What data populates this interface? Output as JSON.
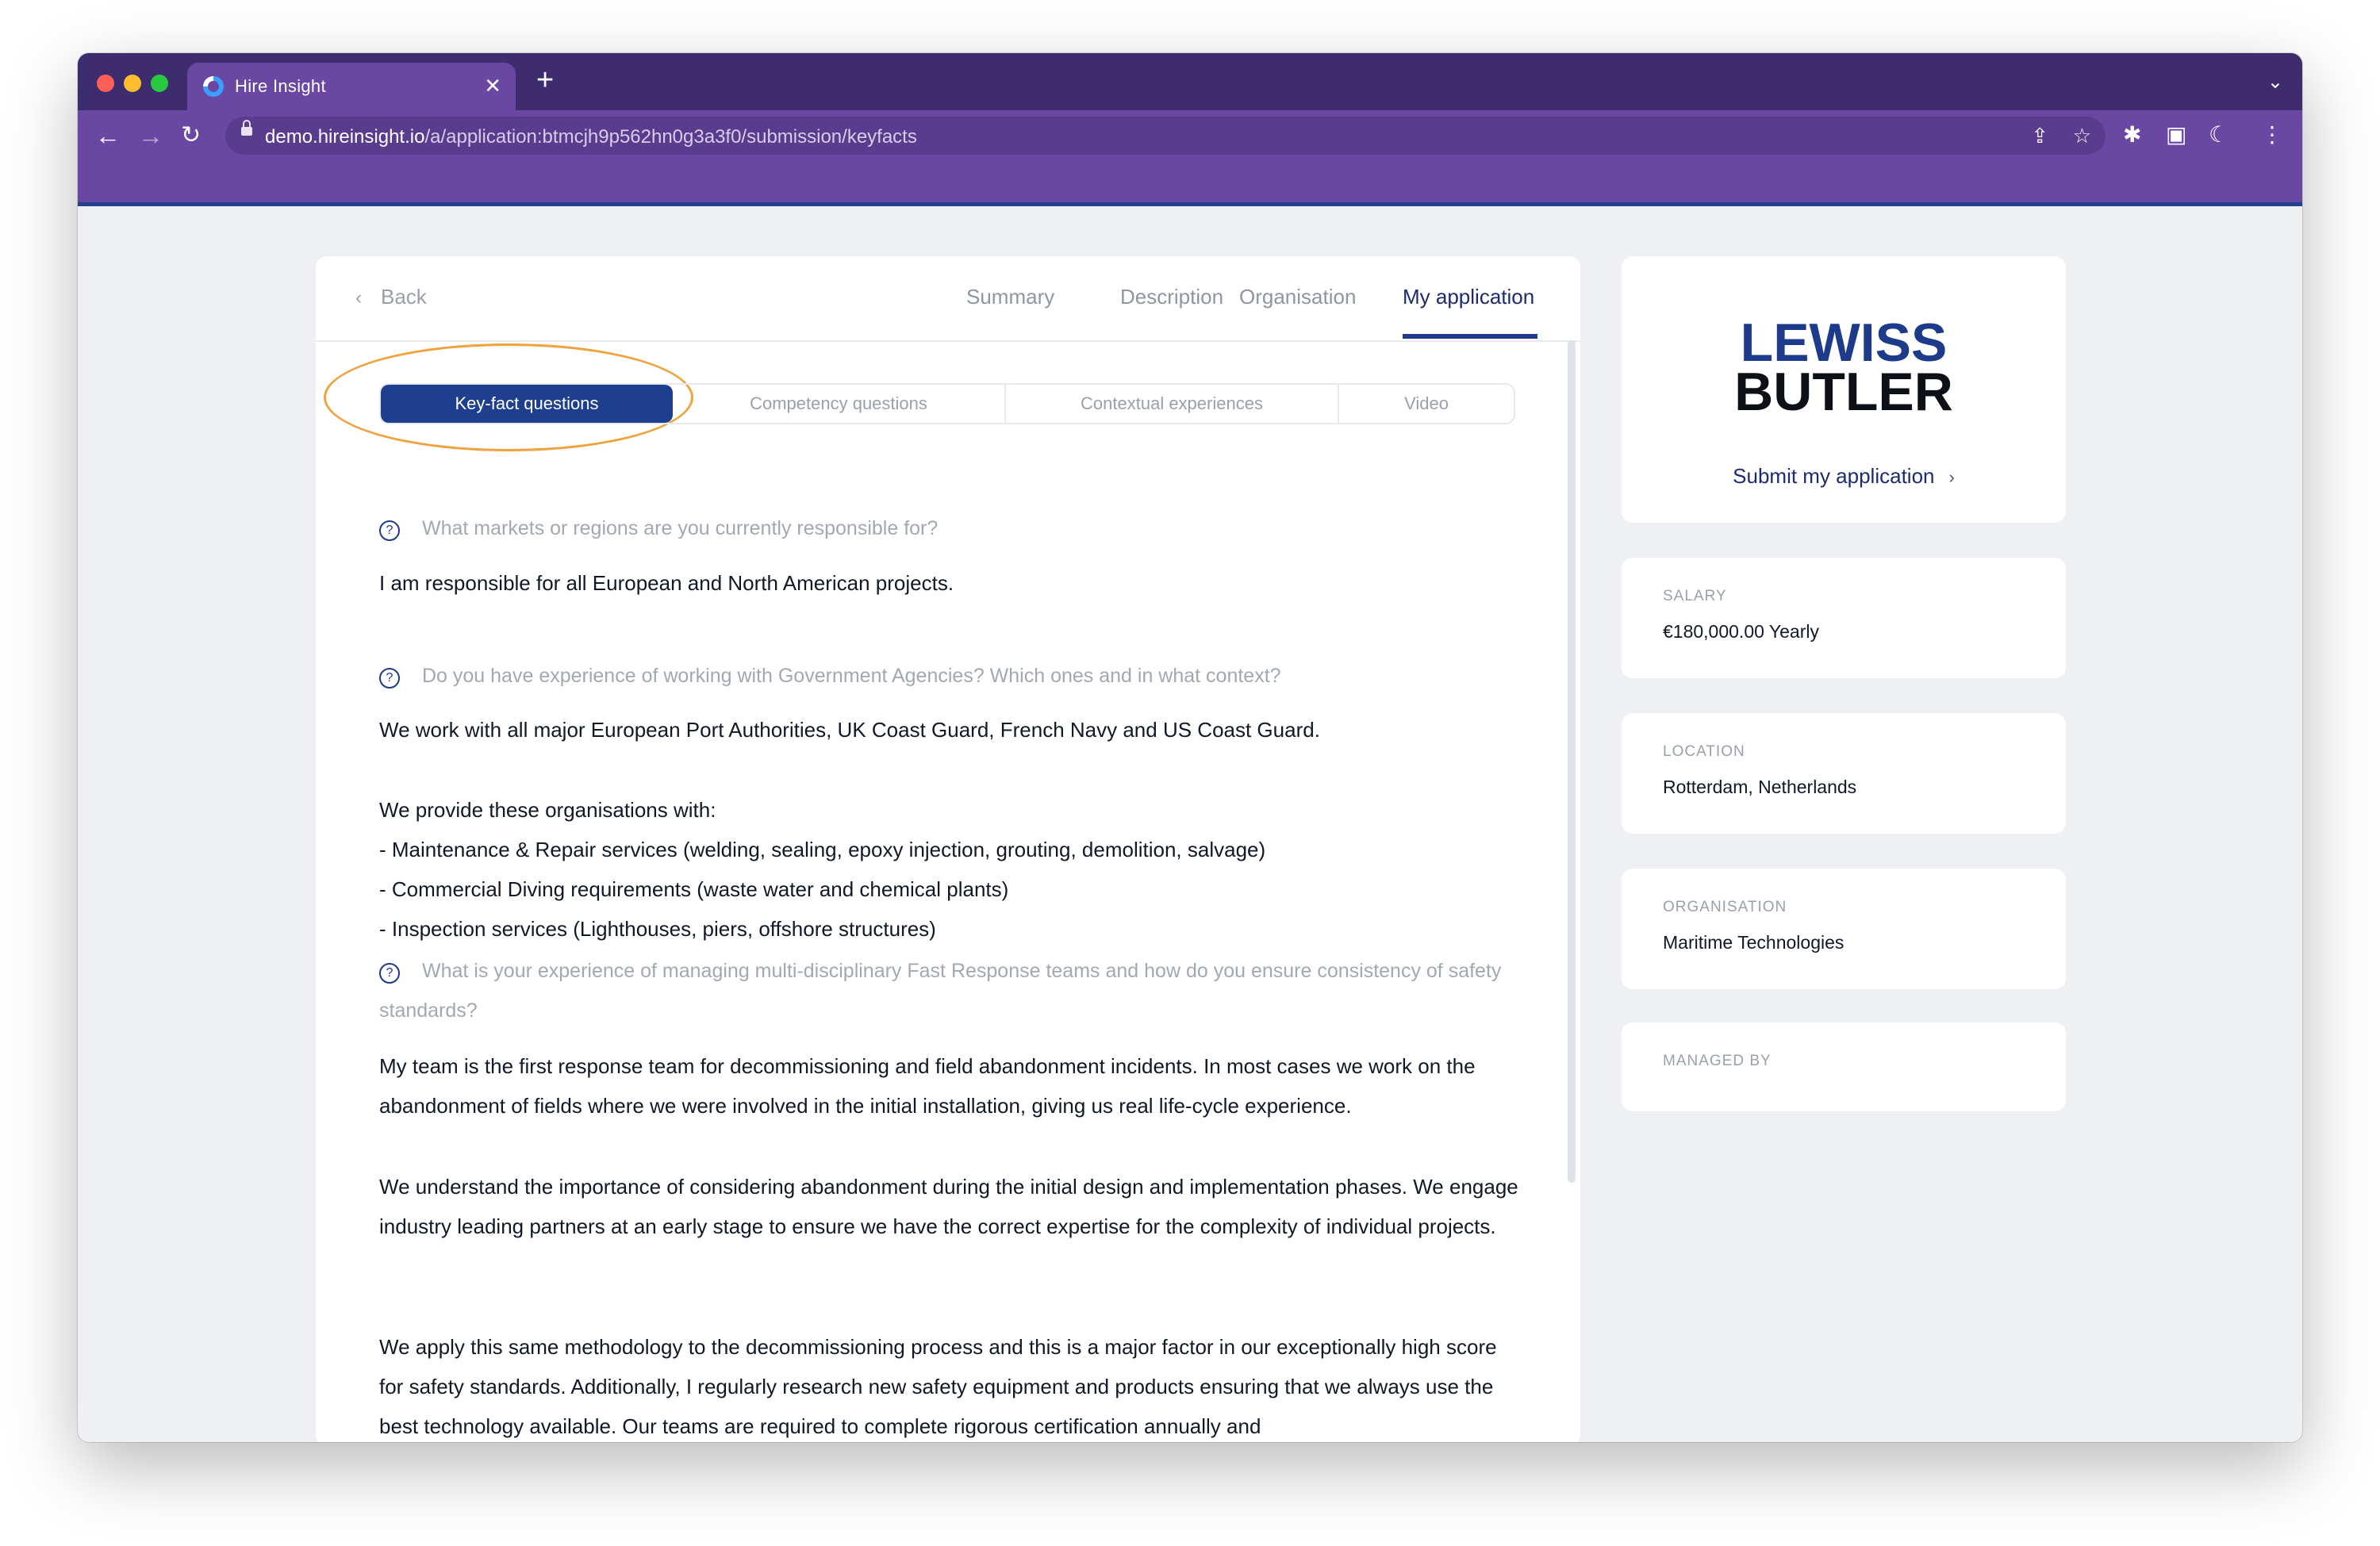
{
  "browser": {
    "tab_title": "Hire Insight",
    "url_host": "demo.hireinsight.io",
    "url_path": "/a/application:btmcjh9p562hn0g3a3f0/submission/keyfacts",
    "icons": [
      "close-icon",
      "plus-icon",
      "chevron-down-icon",
      "back-arrow-icon",
      "forward-arrow-icon",
      "reload-icon",
      "lock-icon",
      "share-icon",
      "star-icon",
      "puzzle-icon",
      "side-panel-icon",
      "profile-icon",
      "more-icon"
    ]
  },
  "nav": {
    "back_label": "Back",
    "tabs": [
      {
        "label": "Summary"
      },
      {
        "label": "Description"
      },
      {
        "label": "Organisation"
      },
      {
        "label": "My application",
        "active": true
      }
    ]
  },
  "subtabs": [
    {
      "label": "Key-fact questions",
      "active": true
    },
    {
      "label": "Competency questions"
    },
    {
      "label": "Contextual experiences"
    },
    {
      "label": "Video"
    }
  ],
  "qa": [
    {
      "question": "What markets or regions are you currently responsible for?",
      "answer": "I am responsible for all European and North American projects."
    },
    {
      "question": "Do you have experience of working with Government Agencies? Which ones and in what context?",
      "answer_intro": "We work with all major European Port Authorities, UK Coast Guard, French Navy and US Coast Guard.",
      "answer_lead": "We provide these organisations with:",
      "answer_bullets": [
        "Maintenance & Repair services (welding, sealing, epoxy injection, grouting, demolition, salvage)",
        "Commercial Diving requirements (waste water and chemical plants)",
        "Inspection services (Lighthouses, piers, offshore structures)"
      ]
    },
    {
      "question": "What is your experience of managing multi-disciplinary Fast Response teams and how do you ensure consistency of safety standards?",
      "answer_paragraphs": [
        "My team is the first response team for decommissioning and field abandonment incidents. In most cases we work on the abandonment of fields where we were involved in the initial installation, giving us real life-cycle experience.",
        "We understand the importance of considering abandonment during the initial design and implementation phases. We engage industry leading partners at an early stage to ensure we have the correct expertise for the complexity of individual projects.",
        "We apply this same methodology to the decommissioning process and this is a major factor in our exceptionally high score for safety standards. Additionally, I regularly research new safety equipment and products ensuring that we always use the best technology available. Our teams are required to complete rigorous certification annually and"
      ]
    }
  ],
  "sidebar": {
    "company_logo": {
      "line1": "LEWISS",
      "line2": "BUTLER"
    },
    "submit_label": "Submit my application",
    "salary_label": "SALARY",
    "salary_value": "€180,000.00 Yearly",
    "location_label": "LOCATION",
    "location_value": "Rotterdam, Netherlands",
    "organisation_label": "ORGANISATION",
    "organisation_value": "Maritime Technologies",
    "managed_by_label": "MANAGED BY"
  },
  "colors": {
    "browser_frame": "#3d2c6e",
    "browser_toolbar": "#6a47a2",
    "brand_navy": "#1e3f8e",
    "annotation": "#f0a23e",
    "page_background": "#eef0f4"
  }
}
